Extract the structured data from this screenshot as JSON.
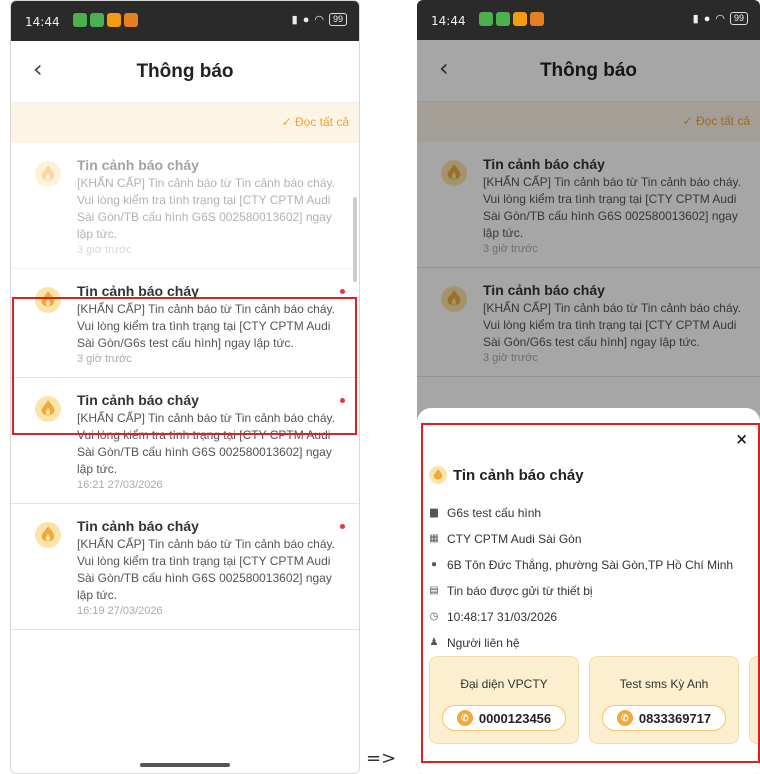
{
  "status_bar": {
    "time": "14:44",
    "battery": "99"
  },
  "header": {
    "title": "Thông báo"
  },
  "read_all": "Đọc tất cả",
  "left_notifications": [
    {
      "title": "Tin cảnh báo cháy",
      "body": "[KHẨN CẤP] Tin cảnh báo từ Tin cảnh báo cháy.\nVui lòng kiểm tra tình trạng tại [CTY CPTM Audi Sài Gòn/TB cấu hình G6S 002580013602] ngay lập tức.",
      "time": "3 giờ trước",
      "unread": false
    },
    {
      "title": "Tin cảnh báo cháy",
      "body": "[KHẨN CẤP] Tin cảnh báo từ Tin cảnh báo cháy.\nVui lòng kiểm tra tình trạng tại [CTY CPTM Audi Sài Gòn/G6s test cấu hình] ngay lập tức.",
      "time": "3 giờ trước",
      "unread": true
    },
    {
      "title": "Tin cảnh báo cháy",
      "body": "[KHẨN CẤP] Tin cảnh báo từ Tin cảnh báo cháy.\nVui lòng kiểm tra tình trạng tại [CTY CPTM Audi Sài Gòn/TB cấu hình G6S 002580013602] ngay lập tức.",
      "time": "16:21 27/03/2026",
      "unread": true
    },
    {
      "title": "Tin cảnh báo cháy",
      "body": "[KHẨN CẤP] Tin cảnh báo từ Tin cảnh báo cháy.\nVui lòng kiểm tra tình trạng tại [CTY CPTM Audi Sài Gòn/TB cấu hình G6S 002580013602] ngay lập tức.",
      "time": "16:19 27/03/2026",
      "unread": true
    }
  ],
  "right_notifications": [
    {
      "title": "Tin cảnh báo cháy",
      "body": "[KHẨN CẤP] Tin cảnh báo từ Tin cảnh báo cháy.\nVui lòng kiểm tra tình trạng tại [CTY CPTM Audi Sài Gòn/TB cấu hình G6S 002580013602] ngay lập tức.",
      "time": "3 giờ trước"
    },
    {
      "title": "Tin cảnh báo cháy",
      "body": "[KHẨN CẤP] Tin cảnh báo từ Tin cảnh báo cháy.\nVui lòng kiểm tra tình trạng tại [CTY CPTM Audi Sài Gòn/G6s test cấu hình] ngay lập tức.",
      "time": "3 giờ trước"
    }
  ],
  "detail": {
    "close": "×",
    "title": "Tin cảnh báo cháy",
    "device": "G6s test cấu hình",
    "company": "CTY CPTM Audi Sài Gòn",
    "address": "6B Tôn Đức Thắng, phường Sài Gòn,TP Hồ Chí Minh",
    "source": "Tin báo được gửi từ thiết bị",
    "timestamp": "10:48:17 31/03/2026",
    "contacts_label": "Người liên hệ",
    "contacts": [
      {
        "name": "Đại diện VPCTY",
        "phone": "0000123456"
      },
      {
        "name": "Test sms Kỳ Anh",
        "phone": "0833369717"
      }
    ]
  },
  "arrow": "=>",
  "colors": {
    "accent": "#f0a23a",
    "highlight": "#e02020",
    "unread_dot": "#e53935"
  }
}
